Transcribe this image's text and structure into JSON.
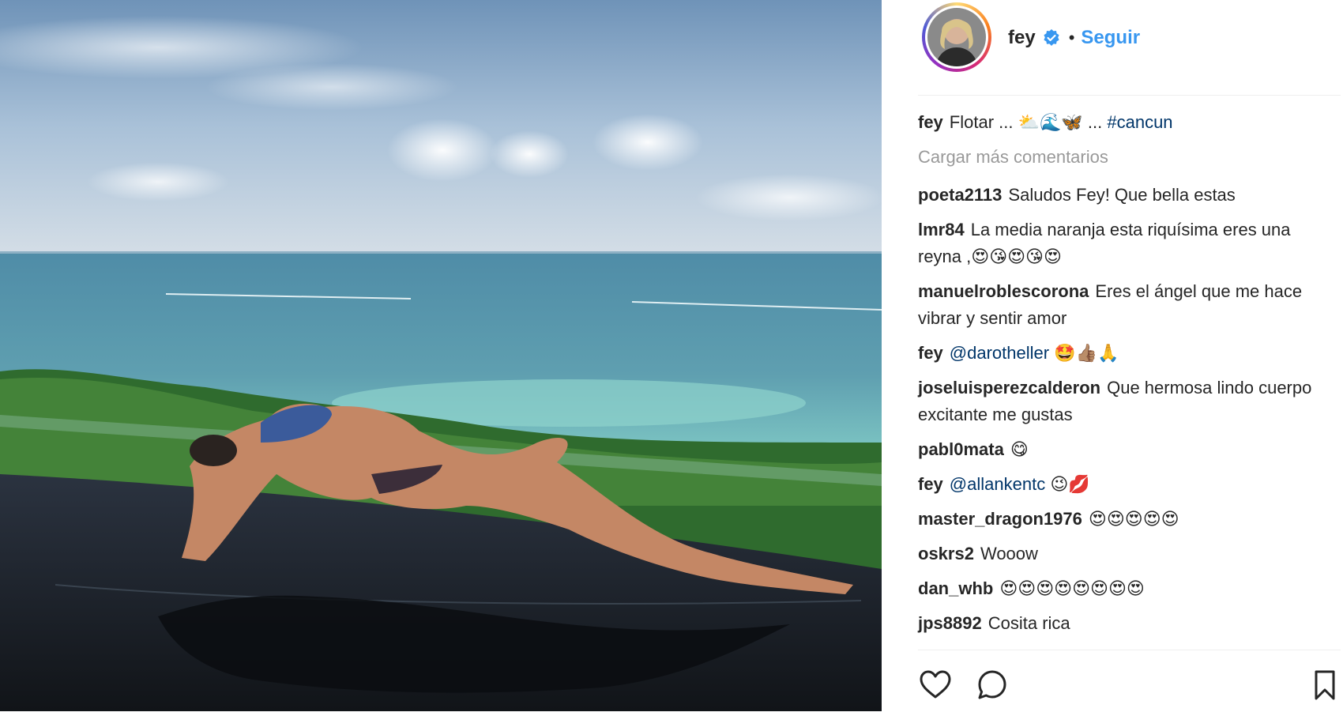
{
  "post": {
    "author": "fey",
    "verified": true,
    "separator": "•",
    "follow_label": "Seguir"
  },
  "caption": {
    "username": "fey",
    "text": "Flotar ... ⛅🌊🦋 ...",
    "hashtag": "#cancun"
  },
  "load_more_label": "Cargar más comentarios",
  "comments": [
    {
      "username": "poeta2113",
      "text": "Saludos Fey! Que bella estas"
    },
    {
      "username": "lmr84",
      "text": "La media naranja esta riquísima eres una reyna ,😍😘😍😘😍"
    },
    {
      "username": "manuelroblescorona",
      "text": "Eres el ángel que me hace vibrar y sentir amor"
    },
    {
      "username": "fey",
      "mention": "@darotheller",
      "text": "🤩👍🏽🙏"
    },
    {
      "username": "joseluisperezcalderon",
      "text": "Que hermosa lindo cuerpo excitante me gustas"
    },
    {
      "username": "pabl0mata",
      "text": "😋"
    },
    {
      "username": "fey",
      "mention": "@allankentc",
      "text": "😉💋"
    },
    {
      "username": "master_dragon1976",
      "text": "😍😍😍😍😍"
    },
    {
      "username": "oskrs2",
      "text": "Wooow"
    },
    {
      "username": "dan_whb",
      "text": "😍😍😍😍😍😍😍😍"
    },
    {
      "username": "jps8892",
      "text": "Cosita rica"
    }
  ],
  "icons": {
    "like": "heart-icon",
    "comment": "comment-icon",
    "save": "bookmark-icon",
    "verified": "verified-badge-icon"
  },
  "colors": {
    "link": "#3897f0",
    "mention": "#003569",
    "muted": "#999999",
    "text": "#262626"
  }
}
